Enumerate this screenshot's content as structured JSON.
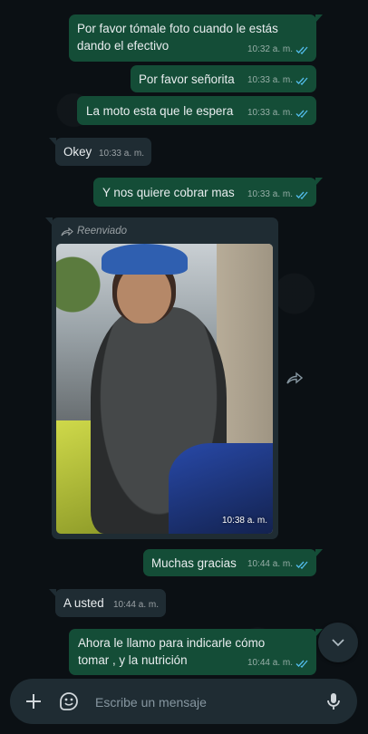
{
  "messages": [
    {
      "text": "Por favor tómale foto cuando le estás dando el efectivo",
      "time": "10:32 a. m."
    },
    {
      "text": "Por favor señorita",
      "time": "10:33 a. m."
    },
    {
      "text": "La moto esta que le espera",
      "time": "10:33 a. m."
    },
    {
      "text": "Okey",
      "time": "10:33 a. m."
    },
    {
      "text": "Y nos quiere cobrar mas",
      "time": "10:33 a. m."
    },
    {
      "forwarded_label": "Reenviado",
      "time": "10:38 a. m."
    },
    {
      "text": "Muchas gracias",
      "time": "10:44 a. m."
    },
    {
      "text": "A usted",
      "time": "10:44 a. m."
    },
    {
      "text": "Ahora le llamo para indicarle cómo tomar , y la nutrición",
      "time": "10:44 a. m."
    }
  ],
  "composer": {
    "placeholder": "Escribe un mensaje"
  },
  "colors": {
    "outgoing": "#144d37",
    "incoming": "#1f2c33",
    "read_ticks": "#53bdeb",
    "background": "#0b1014"
  },
  "icons": [
    "double-check-icon",
    "forward-icon",
    "chevron-down-icon",
    "plus-icon",
    "sticker-icon",
    "mic-icon"
  ]
}
